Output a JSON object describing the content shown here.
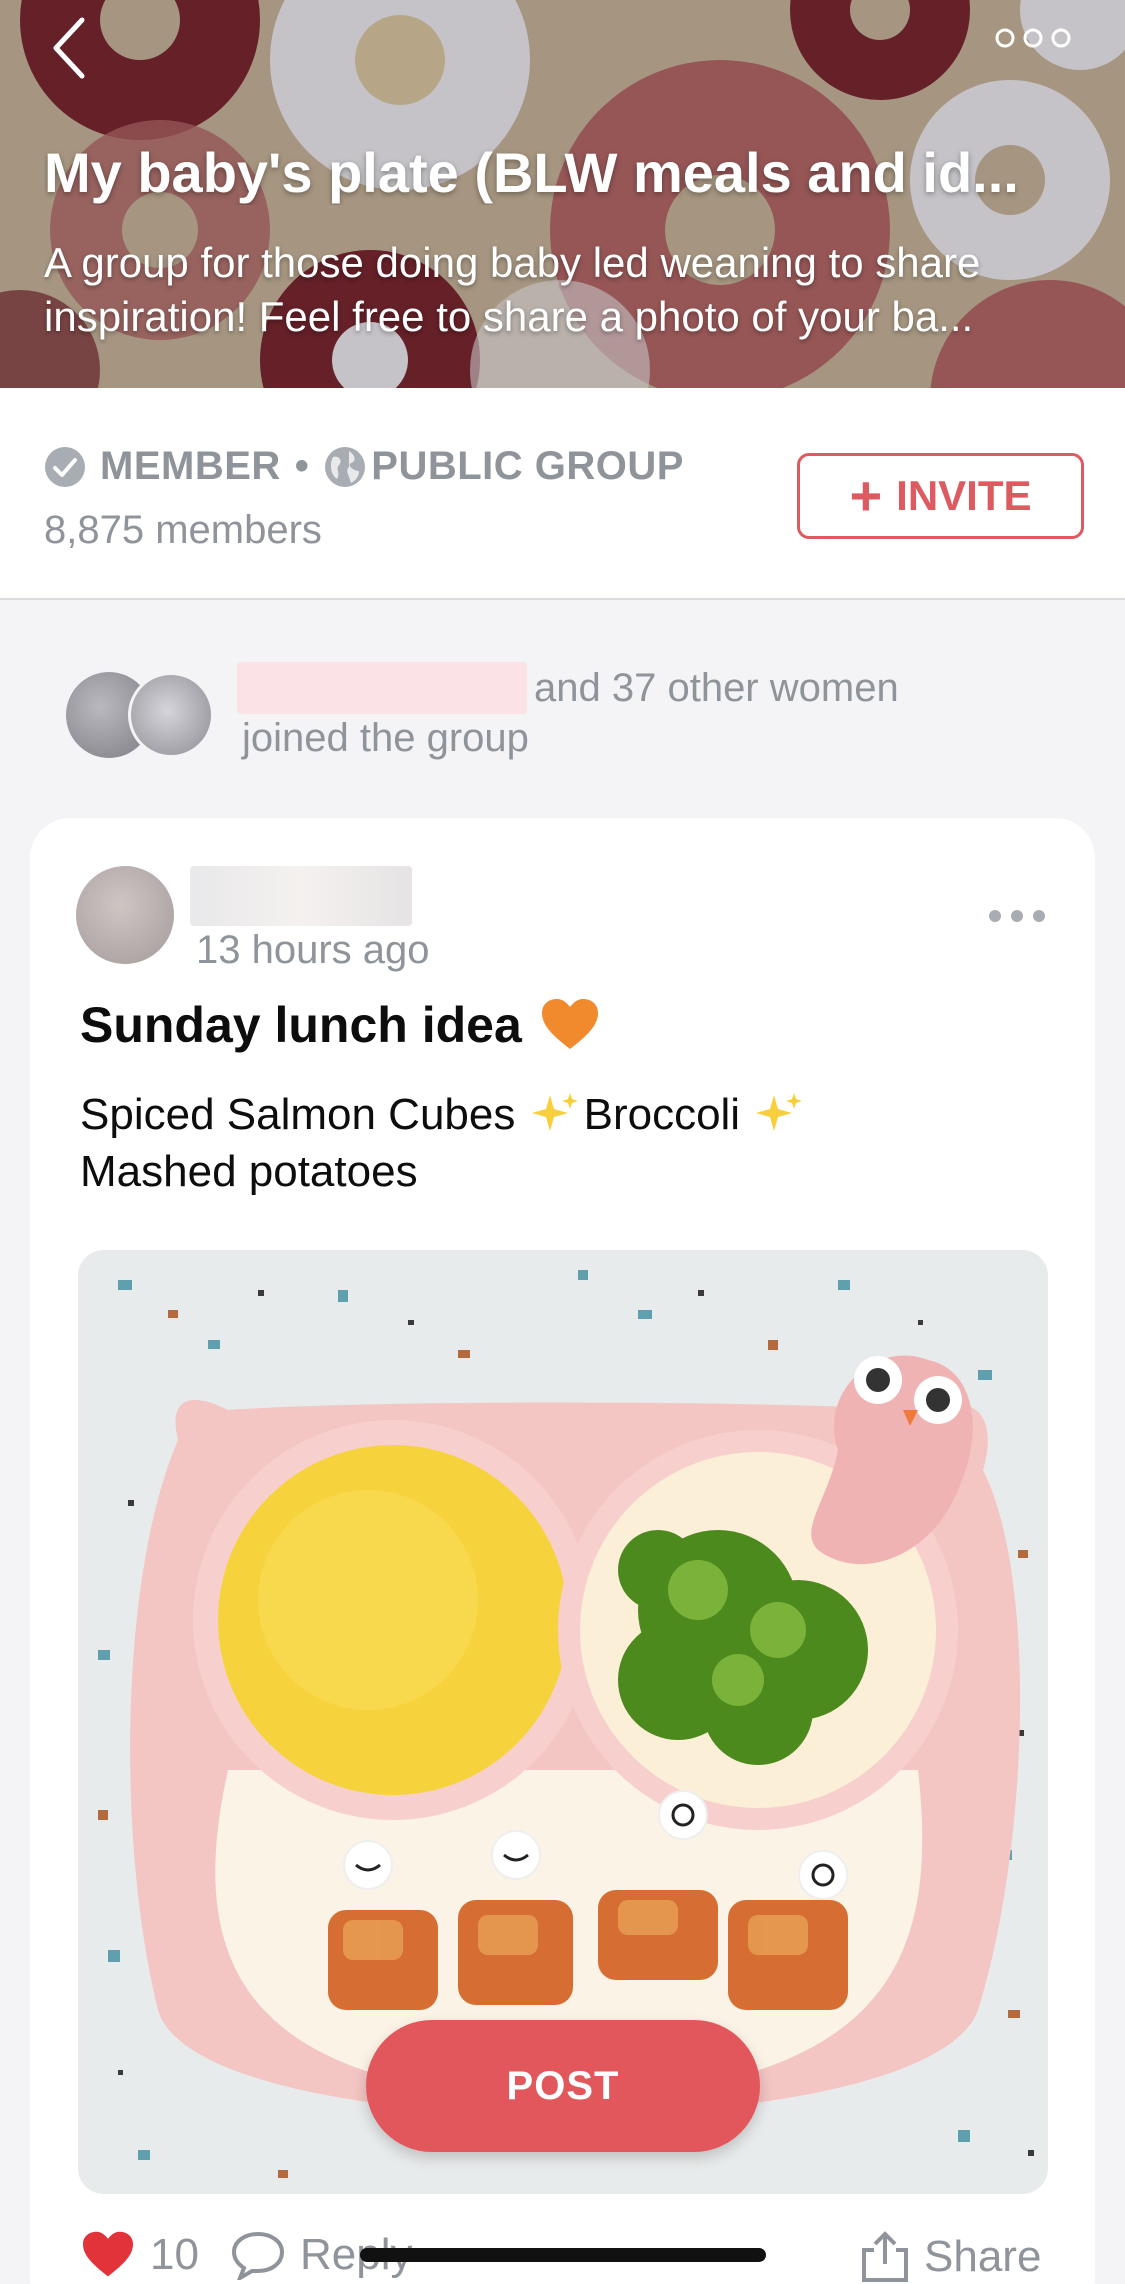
{
  "header": {
    "title": "My baby's plate (BLW meals and id...",
    "description": "A group for those doing baby led weaning to share inspiration! Feel free to share a photo of your ba..."
  },
  "info": {
    "member_label": "MEMBER",
    "separator": "•",
    "group_type": "PUBLIC GROUP",
    "members_count": "8,875 members",
    "invite_label": "INVITE",
    "invite_plus": "+"
  },
  "joined": {
    "text_line1": "and 37 other women",
    "text_line2": "joined the group"
  },
  "post": {
    "time": "13 hours ago",
    "title": "Sunday lunch idea",
    "body_part1": "Spiced Salmon Cubes",
    "body_part2": "Broccoli",
    "body_part3": "Mashed potatoes",
    "likes": "10",
    "reply_label": "Reply",
    "share_label": "Share"
  },
  "fab": {
    "label": "POST"
  },
  "colors": {
    "accent": "#e2575c",
    "muted_text": "#8f949b",
    "header_bg": "#b9a892"
  },
  "icons": [
    "back-chevron-icon",
    "more-dots-icon",
    "check-circle-icon",
    "globe-icon",
    "heart-icon",
    "comment-icon",
    "share-icon",
    "sparkles-icon"
  ]
}
